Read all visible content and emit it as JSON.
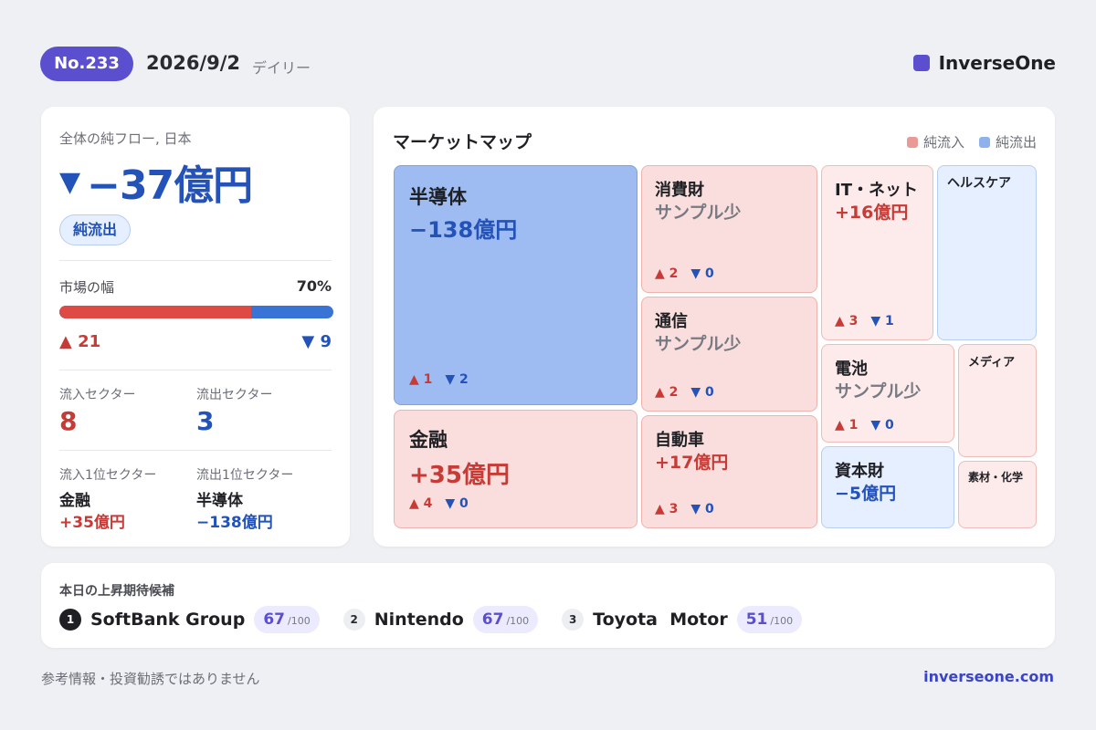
{
  "header": {
    "issue": "No.233",
    "date": "2026/9/2",
    "frequency": "デイリー",
    "brand": "InverseOne",
    "brand_color": "#5b4fcf"
  },
  "summary": {
    "label": "全体の純フロー, 日本",
    "direction_icon": "down-triangle-icon",
    "direction_glyph": "▼",
    "value": "−37億円",
    "status": "純流出",
    "breadth_label": "市場の幅",
    "breadth_pct": "70%",
    "breadth_fraction": 0.7,
    "up_text": "▲ 21",
    "down_text": "▼ 9",
    "inflow_sectors_label": "流入セクター",
    "inflow_sectors": "8",
    "outflow_sectors_label": "流出セクター",
    "outflow_sectors": "3",
    "top_inflow_label": "流入1位セクター",
    "top_inflow_name": "金融",
    "top_inflow_value": "+35億円",
    "top_outflow_label": "流出1位セクター",
    "top_outflow_name": "半導体",
    "top_outflow_value": "−138億円"
  },
  "market_map": {
    "title": "マーケットマップ",
    "legend_in": "純流入",
    "legend_out": "純流出",
    "legend_in_color": "#e99996",
    "legend_out_color": "#8fb1ec",
    "tiles": {
      "semis": {
        "name": "半導体",
        "value": "−138億円",
        "up": "▲ 1",
        "down": "▼ 2"
      },
      "finance": {
        "name": "金融",
        "value": "+35億円",
        "up": "▲ 4",
        "down": "▼ 0"
      },
      "consumer": {
        "name": "消費財",
        "value": "サンプル少",
        "up": "▲ 2",
        "down": "▼ 0"
      },
      "telecom": {
        "name": "通信",
        "value": "サンプル少",
        "up": "▲ 2",
        "down": "▼ 0"
      },
      "auto": {
        "name": "自動車",
        "value": "+17億円",
        "up": "▲ 3",
        "down": "▼ 0"
      },
      "it": {
        "name": "IT・ネット",
        "value": "+16億円",
        "up": "▲ 3",
        "down": "▼ 1"
      },
      "health": {
        "name": "ヘルスケア"
      },
      "battery": {
        "name": "電池",
        "value": "サンプル少",
        "up": "▲ 1",
        "down": "▼ 0"
      },
      "media": {
        "name": "メディア"
      },
      "capital": {
        "name": "資本財",
        "value": "−5億円"
      },
      "materials": {
        "name": "素材・化学"
      }
    }
  },
  "candidates": {
    "title": "本日の上昇期待候補",
    "items": [
      {
        "rank": "1",
        "name": "SoftBank Group",
        "score": "67",
        "max": "/100"
      },
      {
        "rank": "2",
        "name": "Nintendo",
        "score": "67",
        "max": "/100"
      },
      {
        "rank": "3",
        "name": "Toyota  Motor",
        "score": "51",
        "max": "/100"
      }
    ]
  },
  "footer": {
    "disclaimer": "参考情報・投資勧誘ではありません",
    "site": "inverseone.com"
  }
}
